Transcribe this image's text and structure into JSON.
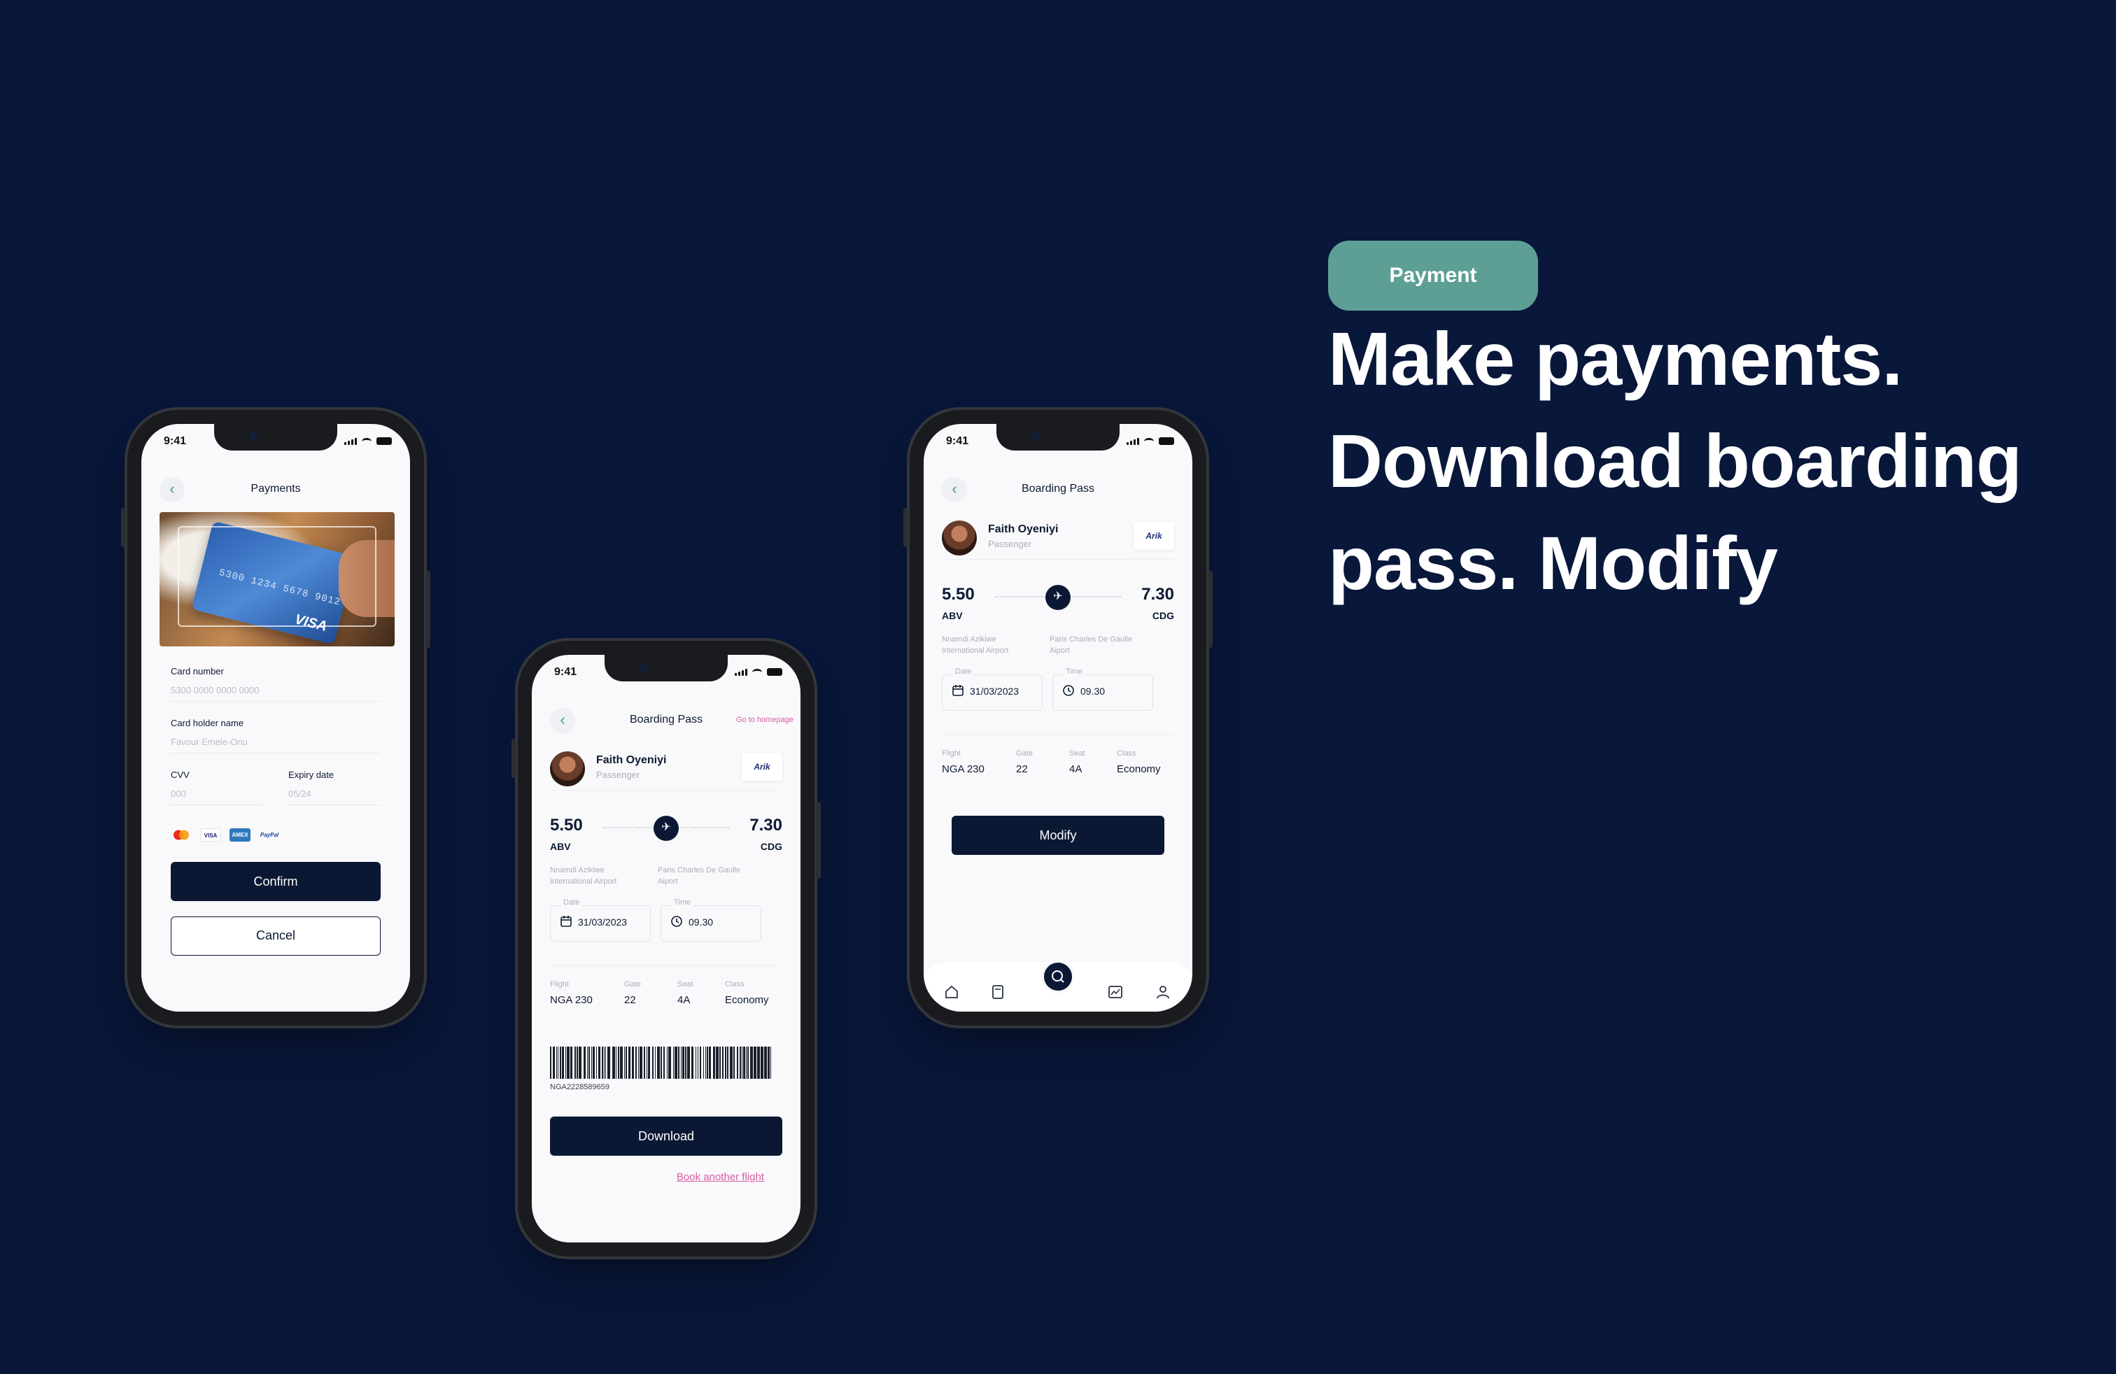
{
  "status_time": "9:41",
  "payment_screen": {
    "title": "Payments",
    "card_photo": {
      "card_number_print": "5300 1234 5678 9012",
      "brand_text": "VISA"
    },
    "card_number": {
      "label": "Card number",
      "placeholder": "5300 0000 0000 0000"
    },
    "card_holder": {
      "label": "Card holder name",
      "placeholder": "Favour Emele-Onu"
    },
    "cvv": {
      "label": "CVV",
      "placeholder": "000"
    },
    "expiry": {
      "label": "Expiry date",
      "placeholder": "05/24"
    },
    "brands": [
      "mastercard",
      "VISA",
      "AMEX",
      "PayPal"
    ],
    "confirm_label": "Confirm",
    "cancel_label": "Cancel"
  },
  "boarding_download": {
    "title": "Boarding Pass",
    "homepage_link": "Go to homepage",
    "passenger": {
      "name": "Faith Oyeniyi",
      "role": "Passenger",
      "airline": "Arik"
    },
    "departure": {
      "time": "5.50",
      "code": "ABV",
      "airport": "Nnamdi Azikiwe International Airport"
    },
    "arrival": {
      "time": "7.30",
      "code": "CDG",
      "airport": "Paris Charles De Gaulle Aiport"
    },
    "date": {
      "label": "Date",
      "value": "31/03/2023"
    },
    "time": {
      "label": "Time",
      "value": "09.30"
    },
    "meta": [
      {
        "label": "Flight",
        "value": "NGA 230"
      },
      {
        "label": "Gate",
        "value": "22"
      },
      {
        "label": "Seat",
        "value": "4A"
      },
      {
        "label": "Class",
        "value": "Economy"
      }
    ],
    "barcode_number": "NGA2228589659",
    "download_label": "Download",
    "book_link": "Book another flight"
  },
  "boarding_modify": {
    "title": "Boarding Pass",
    "passenger": {
      "name": "Faith Oyeniyi",
      "role": "Passenger",
      "airline": "Arik"
    },
    "departure": {
      "time": "5.50",
      "code": "ABV",
      "airport": "Nnamdi Azikiwe International Airport"
    },
    "arrival": {
      "time": "7.30",
      "code": "CDG",
      "airport": "Paris Charles De Gaulle Aiport"
    },
    "date": {
      "label": "Date",
      "value": "31/03/2023"
    },
    "time": {
      "label": "Time",
      "value": "09.30"
    },
    "meta": [
      {
        "label": "Flight",
        "value": "NGA 230"
      },
      {
        "label": "Gate",
        "value": "22"
      },
      {
        "label": "Seat",
        "value": "4A"
      },
      {
        "label": "Class",
        "value": "Economy"
      }
    ],
    "modify_label": "Modify",
    "nav_icons": [
      "home-icon",
      "ticket-icon",
      "search-icon",
      "chart-icon",
      "user-icon"
    ]
  },
  "badge": "Payment",
  "headline": "Make payments. Download boarding pass. Modify",
  "colors": {
    "background": "#08173a",
    "badge": "#5e9f95",
    "primary_button": "#0b1834",
    "link": "#d45ea0"
  }
}
